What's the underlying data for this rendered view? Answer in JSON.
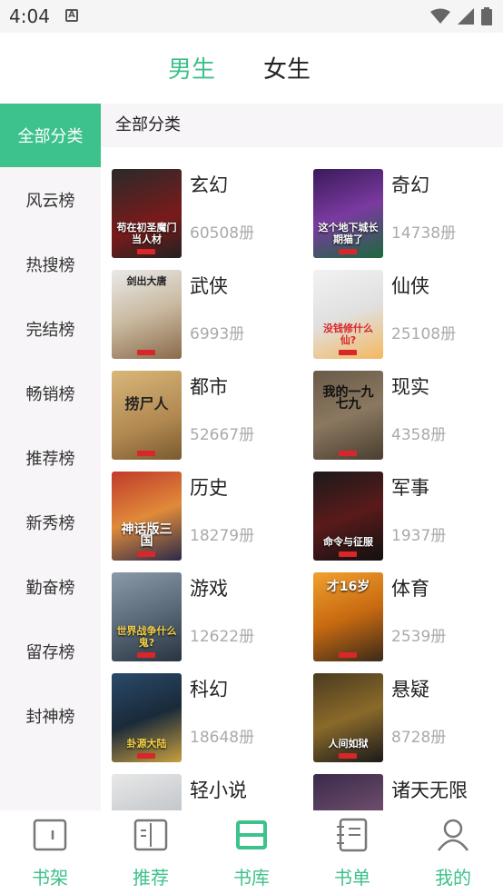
{
  "status": {
    "time": "4:04",
    "a_badge": "A"
  },
  "gender_tabs": [
    {
      "label": "男生"
    },
    {
      "label": "女生"
    }
  ],
  "sidebar": {
    "items": [
      {
        "label": "全部分类"
      },
      {
        "label": "风云榜"
      },
      {
        "label": "热搜榜"
      },
      {
        "label": "完结榜"
      },
      {
        "label": "畅销榜"
      },
      {
        "label": "推荐榜"
      },
      {
        "label": "新秀榜"
      },
      {
        "label": "勤奋榜"
      },
      {
        "label": "留存榜"
      },
      {
        "label": "封神榜"
      }
    ]
  },
  "main": {
    "header": "全部分类",
    "categories": [
      {
        "name": "玄幻",
        "count": "60508册",
        "cover_text": "苟在初圣魔门当人材"
      },
      {
        "name": "奇幻",
        "count": "14738册",
        "cover_text": "这个地下城长期猫了"
      },
      {
        "name": "武侠",
        "count": "6993册",
        "cover_text": "剑出大唐"
      },
      {
        "name": "仙侠",
        "count": "25108册",
        "cover_text": "没钱修什么仙?"
      },
      {
        "name": "都市",
        "count": "52667册",
        "cover_text": "捞尸人"
      },
      {
        "name": "现实",
        "count": "4358册",
        "cover_text": "我的一九七九"
      },
      {
        "name": "历史",
        "count": "18279册",
        "cover_text": "神话版三国"
      },
      {
        "name": "军事",
        "count": "1937册",
        "cover_text": "命令与征服"
      },
      {
        "name": "游戏",
        "count": "12622册",
        "cover_text": "世界战争什么鬼?"
      },
      {
        "name": "体育",
        "count": "2539册",
        "cover_text": "才16岁"
      },
      {
        "name": "科幻",
        "count": "18648册",
        "cover_text": "卦源大陆"
      },
      {
        "name": "悬疑",
        "count": "8728册",
        "cover_text": "人间如狱"
      },
      {
        "name": "轻小说",
        "count": "",
        "cover_text": ""
      },
      {
        "name": "诸天无限",
        "count": "",
        "cover_text": ""
      }
    ]
  },
  "bottom_nav": [
    {
      "label": "书架",
      "icon": "bookshelf-icon"
    },
    {
      "label": "推荐",
      "icon": "open-book-icon"
    },
    {
      "label": "书库",
      "icon": "library-icon"
    },
    {
      "label": "书单",
      "icon": "notebook-icon"
    },
    {
      "label": "我的",
      "icon": "user-icon"
    }
  ],
  "colors": {
    "accent": "#3cc28a",
    "sidebar_bg": "#f7f5f7"
  }
}
